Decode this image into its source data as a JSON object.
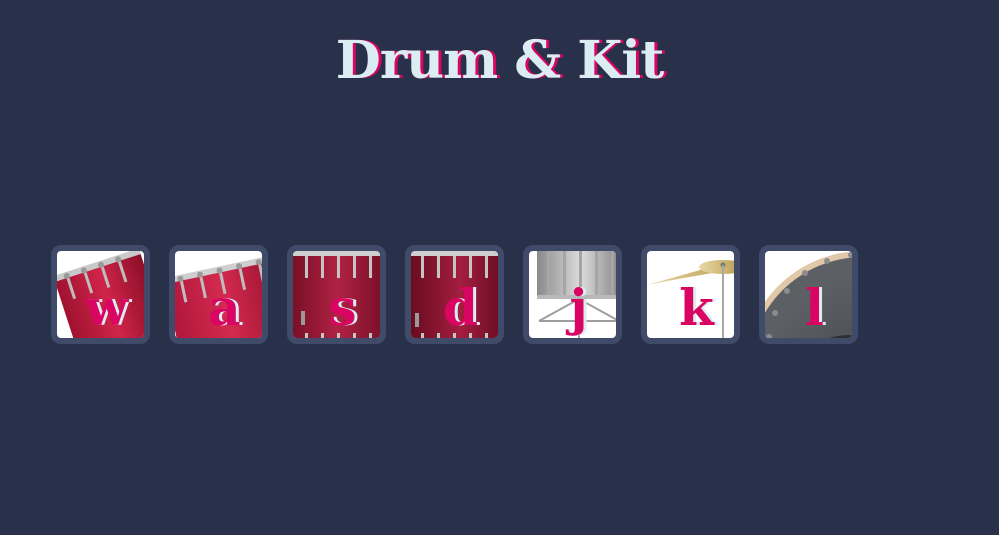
{
  "title": "Drum & Kit",
  "drums": [
    {
      "key": "w",
      "instrument": "tom-1"
    },
    {
      "key": "a",
      "instrument": "tom-2"
    },
    {
      "key": "s",
      "instrument": "tom-3"
    },
    {
      "key": "d",
      "instrument": "tom-4"
    },
    {
      "key": "j",
      "instrument": "snare"
    },
    {
      "key": "k",
      "instrument": "crash"
    },
    {
      "key": "l",
      "instrument": "kick-bass"
    }
  ],
  "colors": {
    "background": "#283149",
    "button_border": "#404b69",
    "key_text": "#da0463",
    "title_text": "#dbedf3"
  }
}
